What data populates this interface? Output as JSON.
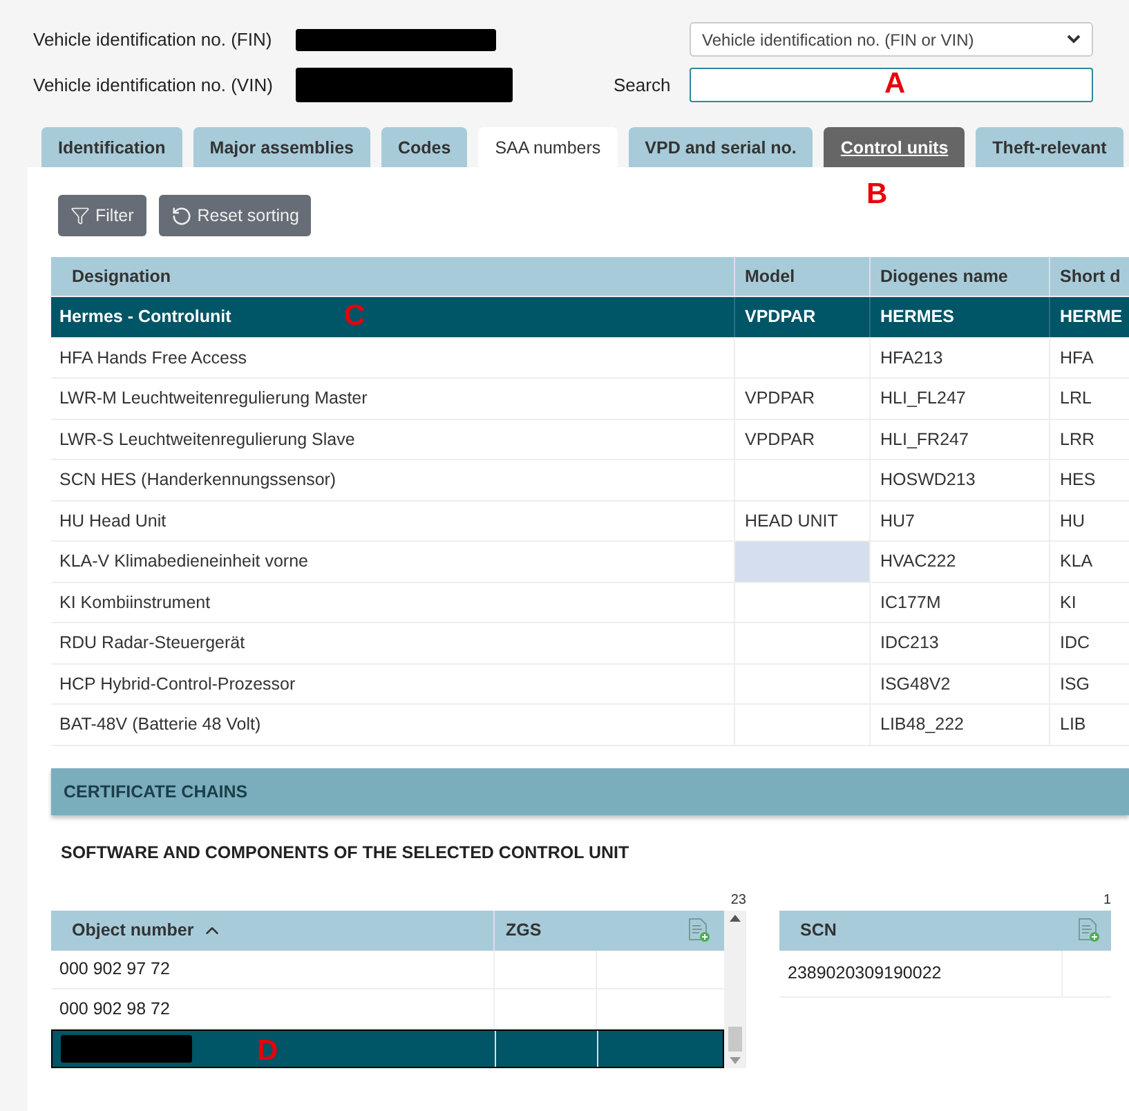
{
  "vehicle": {
    "fin_label": "Vehicle identification no. (FIN)",
    "vin_label": "Vehicle identification no. (VIN)"
  },
  "search": {
    "mode": "Vehicle identification no. (FIN or VIN)",
    "label": "Search",
    "marker": "A"
  },
  "tabs": [
    {
      "label": "Identification",
      "selected": false,
      "highlighted": false
    },
    {
      "label": "Major assemblies",
      "selected": false,
      "highlighted": false
    },
    {
      "label": "Codes",
      "selected": false,
      "highlighted": false
    },
    {
      "label": "SAA numbers",
      "selected": false,
      "highlighted": true
    },
    {
      "label": "VPD and serial no.",
      "selected": false,
      "highlighted": false
    },
    {
      "label": "Control units",
      "selected": true,
      "highlighted": false
    },
    {
      "label": "Theft-relevant",
      "selected": false,
      "highlighted": false
    }
  ],
  "toolbar": {
    "buttons": [
      {
        "kind": "filter",
        "label": "Filter"
      },
      {
        "kind": "reset",
        "label": "Reset sorting"
      }
    ],
    "marker": "B"
  },
  "table": {
    "columns": [
      "Designation",
      "Model",
      "Diogenes name",
      "Short d"
    ],
    "rows": [
      {
        "cells": [
          "Hermes - Controlunit",
          "VPDPAR",
          "HERMES",
          "HERME"
        ],
        "selected": true,
        "marker": "C",
        "highlighted": [
          false,
          false,
          false,
          false
        ]
      },
      {
        "cells": [
          "HFA Hands Free Access",
          "",
          "HFA213",
          "HFA"
        ],
        "selected": false,
        "highlighted": [
          false,
          false,
          false,
          false
        ]
      },
      {
        "cells": [
          "LWR-M Leuchtweitenregulierung Master",
          "VPDPAR",
          "HLI_FL247",
          "LRL"
        ],
        "selected": false,
        "highlighted": [
          false,
          false,
          false,
          false
        ]
      },
      {
        "cells": [
          "LWR-S Leuchtweitenregulierung Slave",
          "VPDPAR",
          "HLI_FR247",
          "LRR"
        ],
        "selected": false,
        "highlighted": [
          false,
          false,
          false,
          false
        ]
      },
      {
        "cells": [
          "SCN HES (Handerkennungssensor)",
          "",
          "HOSWD213",
          "HES"
        ],
        "selected": false,
        "highlighted": [
          false,
          false,
          false,
          false
        ]
      },
      {
        "cells": [
          "HU Head Unit",
          "HEAD UNIT",
          "HU7",
          "HU"
        ],
        "selected": false,
        "highlighted": [
          false,
          false,
          false,
          false
        ]
      },
      {
        "cells": [
          "KLA-V Klimabedieneinheit vorne",
          "",
          "HVAC222",
          "KLA"
        ],
        "selected": false,
        "highlighted": [
          false,
          true,
          false,
          false
        ]
      },
      {
        "cells": [
          "KI Kombiinstrument",
          "",
          "IC177M",
          "KI"
        ],
        "selected": false,
        "highlighted": [
          false,
          false,
          false,
          false
        ]
      },
      {
        "cells": [
          "RDU Radar-Steuergerät",
          "",
          "IDC213",
          "IDC"
        ],
        "selected": false,
        "highlighted": [
          false,
          false,
          false,
          false
        ]
      },
      {
        "cells": [
          "HCP Hybrid-Control-Prozessor",
          "",
          "ISG48V2",
          "ISG"
        ],
        "selected": false,
        "highlighted": [
          false,
          false,
          false,
          false
        ]
      },
      {
        "cells": [
          "BAT-48V (Batterie 48 Volt)",
          "",
          "LIB48_222",
          "LIB"
        ],
        "selected": false,
        "highlighted": [
          false,
          false,
          false,
          false
        ]
      }
    ]
  },
  "certificate_chains": {
    "title": "CERTIFICATE CHAINS"
  },
  "software": {
    "title": "SOFTWARE AND COMPONENTS OF THE SELECTED CONTROL UNIT",
    "parts": {
      "count": "23",
      "columns": [
        "Object number",
        "ZGS"
      ],
      "rows": [
        {
          "cells": [
            "000 902 97 72",
            "",
            ""
          ],
          "selected": false
        },
        {
          "cells": [
            "000 902 98 72",
            "",
            ""
          ],
          "selected": false
        },
        {
          "cells": [
            "",
            "",
            ""
          ],
          "selected": true,
          "marker": "D"
        }
      ]
    },
    "scn": {
      "count": "1",
      "columns": [
        "SCN"
      ],
      "rows": [
        {
          "cells": [
            "2389020309190022",
            ""
          ]
        }
      ]
    }
  }
}
